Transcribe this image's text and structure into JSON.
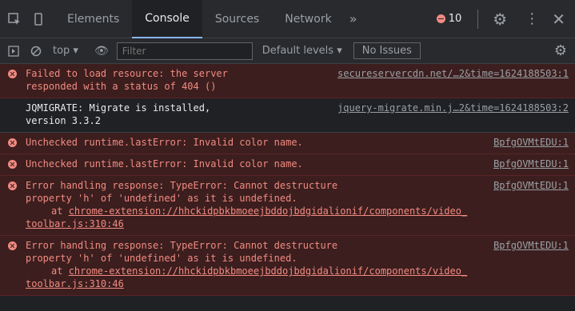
{
  "tabs": [
    "Elements",
    "Console",
    "Sources",
    "Network"
  ],
  "more_tabs": "»",
  "error_count": "10",
  "toolbar": {
    "context": "top ▾",
    "filter_placeholder": "Filter",
    "levels": "Default levels ▾",
    "issues": "No Issues"
  },
  "messages": [
    {
      "type": "error",
      "text1": "Failed to load resource: the server",
      "link": "secureservercdn.net/…2&time=1624188503:1",
      "text2": "responded with a status of 404 ()"
    },
    {
      "type": "info",
      "text1": "JQMIGRATE: Migrate is installed,",
      "link": "jquery-migrate.min.j…2&time=1624188503:2",
      "text2": "version 3.3.2"
    },
    {
      "type": "error",
      "text1": "Unchecked runtime.lastError: Invalid color name.",
      "link": "BpfgOVMtEDU:1"
    },
    {
      "type": "error",
      "text1": "Unchecked runtime.lastError: Invalid color name.",
      "link": "BpfgOVMtEDU:1"
    },
    {
      "type": "error",
      "text1": "Error handling response: TypeError: Cannot destructure",
      "link": "BpfgOVMtEDU:1",
      "text2": "property 'h' of 'undefined' as it is undefined.",
      "at_prefix": "at",
      "at_link": "chrome-extension://hhckidpbkbmoeejbddojbdgidalionif/components/video_",
      "at_link2": "toolbar.js:310:46"
    },
    {
      "type": "error",
      "text1": "Error handling response: TypeError: Cannot destructure",
      "link": "BpfgOVMtEDU:1",
      "text2": "property 'h' of 'undefined' as it is undefined.",
      "at_prefix": "at",
      "at_link": "chrome-extension://hhckidpbkbmoeejbddojbdgidalionif/components/video_",
      "at_link2": "toolbar.js:310:46"
    }
  ]
}
